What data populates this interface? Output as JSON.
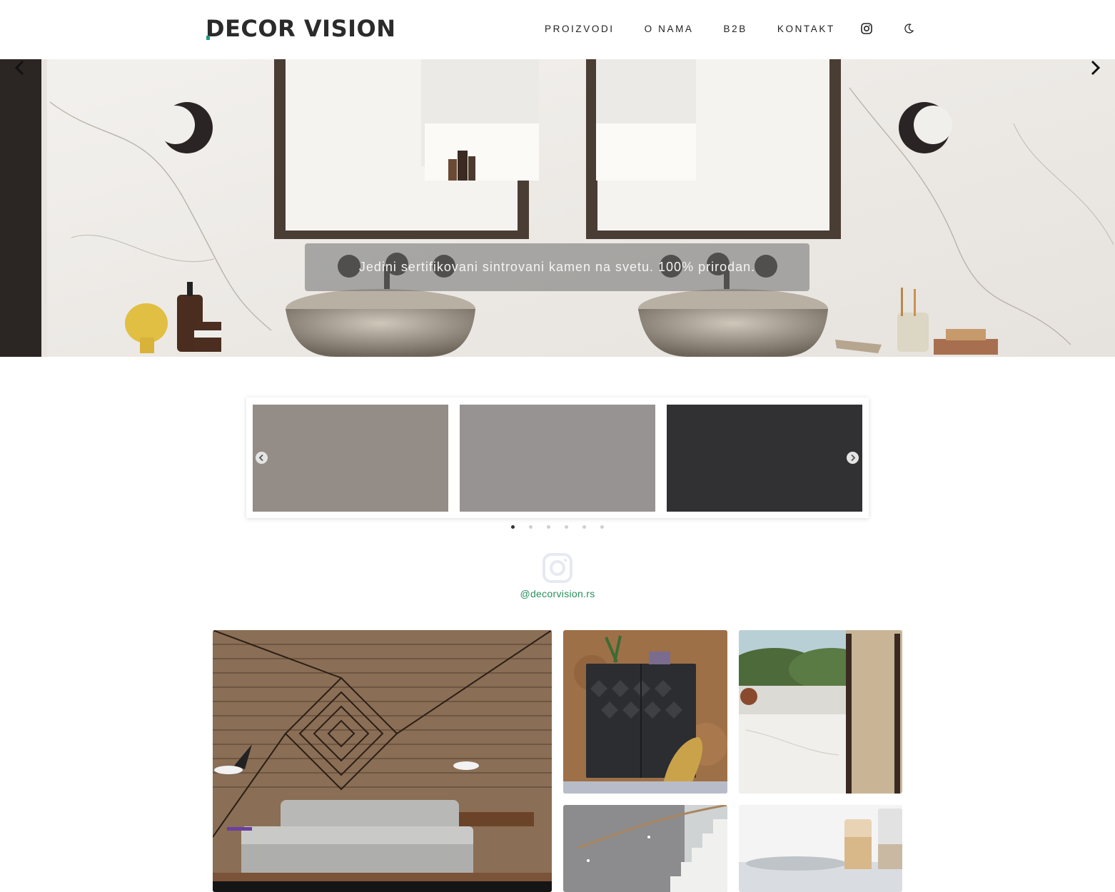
{
  "header": {
    "logo_text": "DECOR VISION",
    "nav": [
      "PROIZVODI",
      "O NAMA",
      "B2B",
      "KONTAKT"
    ],
    "icons": [
      "instagram-icon",
      "moon-icon"
    ]
  },
  "hero": {
    "caption": "Jedini sertifikovani sintrovani kamen na svetu. 100% prirodan.",
    "prev_icon": "chevron-left-icon",
    "next_icon": "chevron-right-icon"
  },
  "swatch_carousel": {
    "swatch_colors": [
      "#948d87",
      "#979392",
      "#313032"
    ],
    "page_count": 6,
    "active_page": 1
  },
  "instagram": {
    "icon": "instagram-icon",
    "handle": "@decorvision.rs"
  },
  "colors": {
    "accent_green": "#2a8f5c",
    "logo_accent": "#1f9a8a",
    "text_dark": "#222222"
  }
}
